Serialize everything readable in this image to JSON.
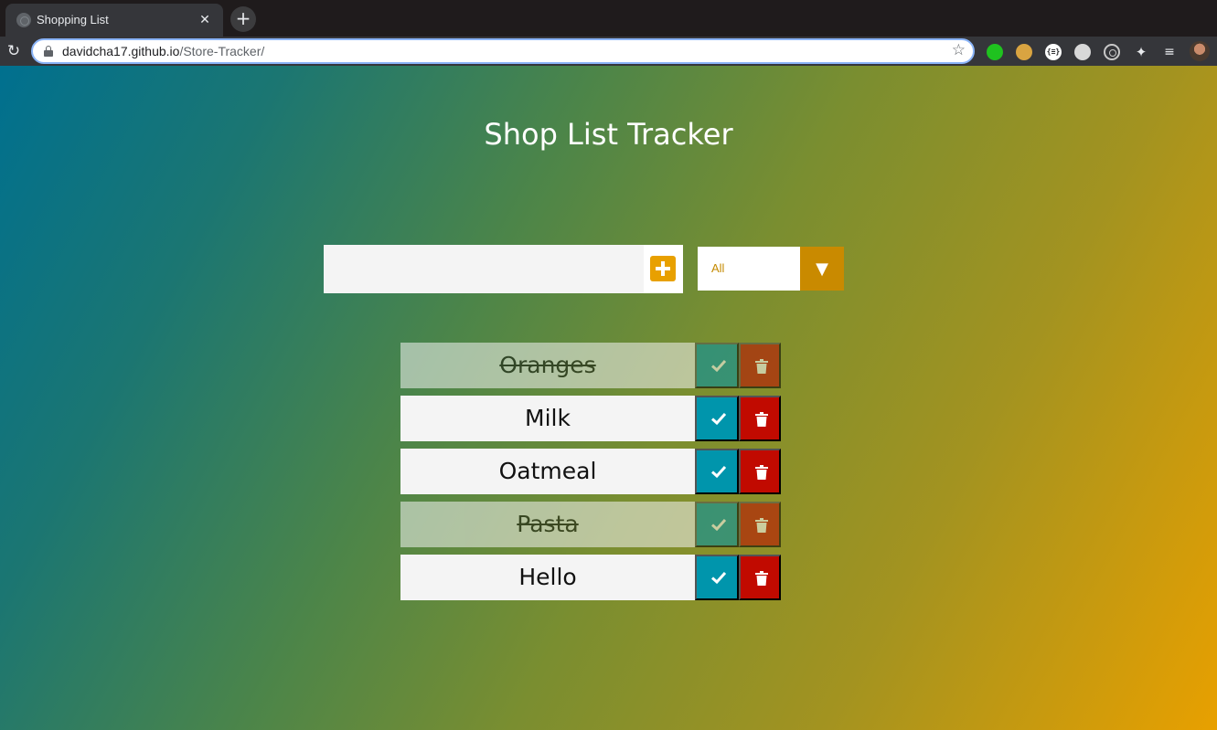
{
  "browser": {
    "tab_title": "Shopping List",
    "tab_close_glyph": "✕",
    "new_tab_glyph": "+",
    "url_host": "davidcha17.github.io",
    "url_path": "/Store-Tracker/",
    "extensions": [
      "green-extension-icon",
      "cookie-extension-icon",
      "json-extension-icon",
      "grid-extension-icon",
      "target-extension-icon",
      "puzzle-icon",
      "media-icon"
    ],
    "json_ext_label": "{≡}"
  },
  "app": {
    "title": "Shop List Tracker",
    "input_value": "",
    "filter_value": "All",
    "filter_arrow": "▼",
    "accent_color": "#e8a000",
    "check_color": "#0095ac",
    "trash_color": "#c10a00",
    "items": [
      {
        "text": "Oranges",
        "completed": true
      },
      {
        "text": "Milk",
        "completed": false
      },
      {
        "text": "Oatmeal",
        "completed": false
      },
      {
        "text": "Pasta",
        "completed": true
      },
      {
        "text": "Hello",
        "completed": false
      }
    ]
  }
}
